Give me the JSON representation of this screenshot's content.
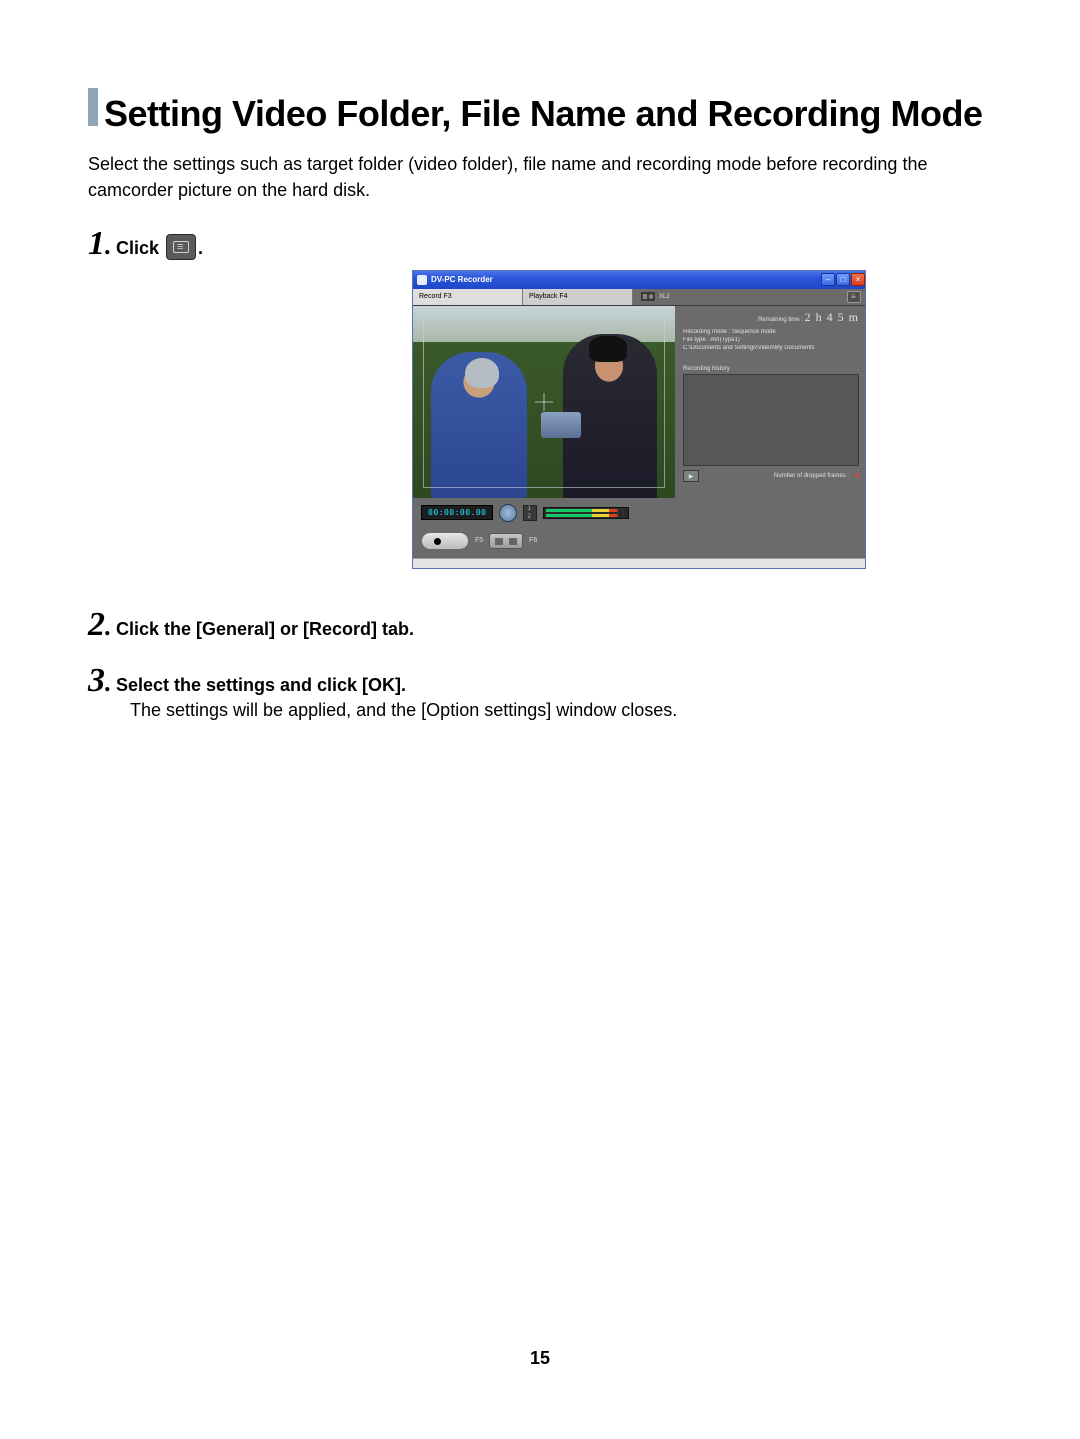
{
  "page": {
    "title": "Setting Video Folder, File Name and Recording Mode",
    "intro": "Select the settings such as target folder (video folder), file name and recording mode before recording the camcorder picture on the hard disk.",
    "number": "15"
  },
  "steps": {
    "s1_num": "1",
    "s1_text_before": "Click ",
    "s1_text_after": ".",
    "s2_num": "2",
    "s2_text": "Click the [General] or [Record] tab.",
    "s3_num": "3",
    "s3_text": "Select the settings and click [OK].",
    "s3_detail": "The settings will be applied, and the [Option settings] window closes."
  },
  "app": {
    "title": "DV-PC Recorder",
    "tabs": {
      "record": "Record F3",
      "playback": "Playback F4"
    },
    "model": "XL2",
    "remaining_label": "Remaining time :",
    "remaining_value": "2 h 4 5 m",
    "info_mode": "Recording mode : Sequence mode",
    "info_type": "File type : AVI(Type1)",
    "info_path": "C:\\Documents and Settings\\Video\\My Documents",
    "history_label": "Recording history",
    "dropped_label": "Number of dropped frames :",
    "dropped_value": "0",
    "play_glyph": "▶",
    "timecode": "00:00:00.00",
    "f5": "F5",
    "f6": "F6",
    "min": "–",
    "max": "□",
    "close": "×"
  }
}
